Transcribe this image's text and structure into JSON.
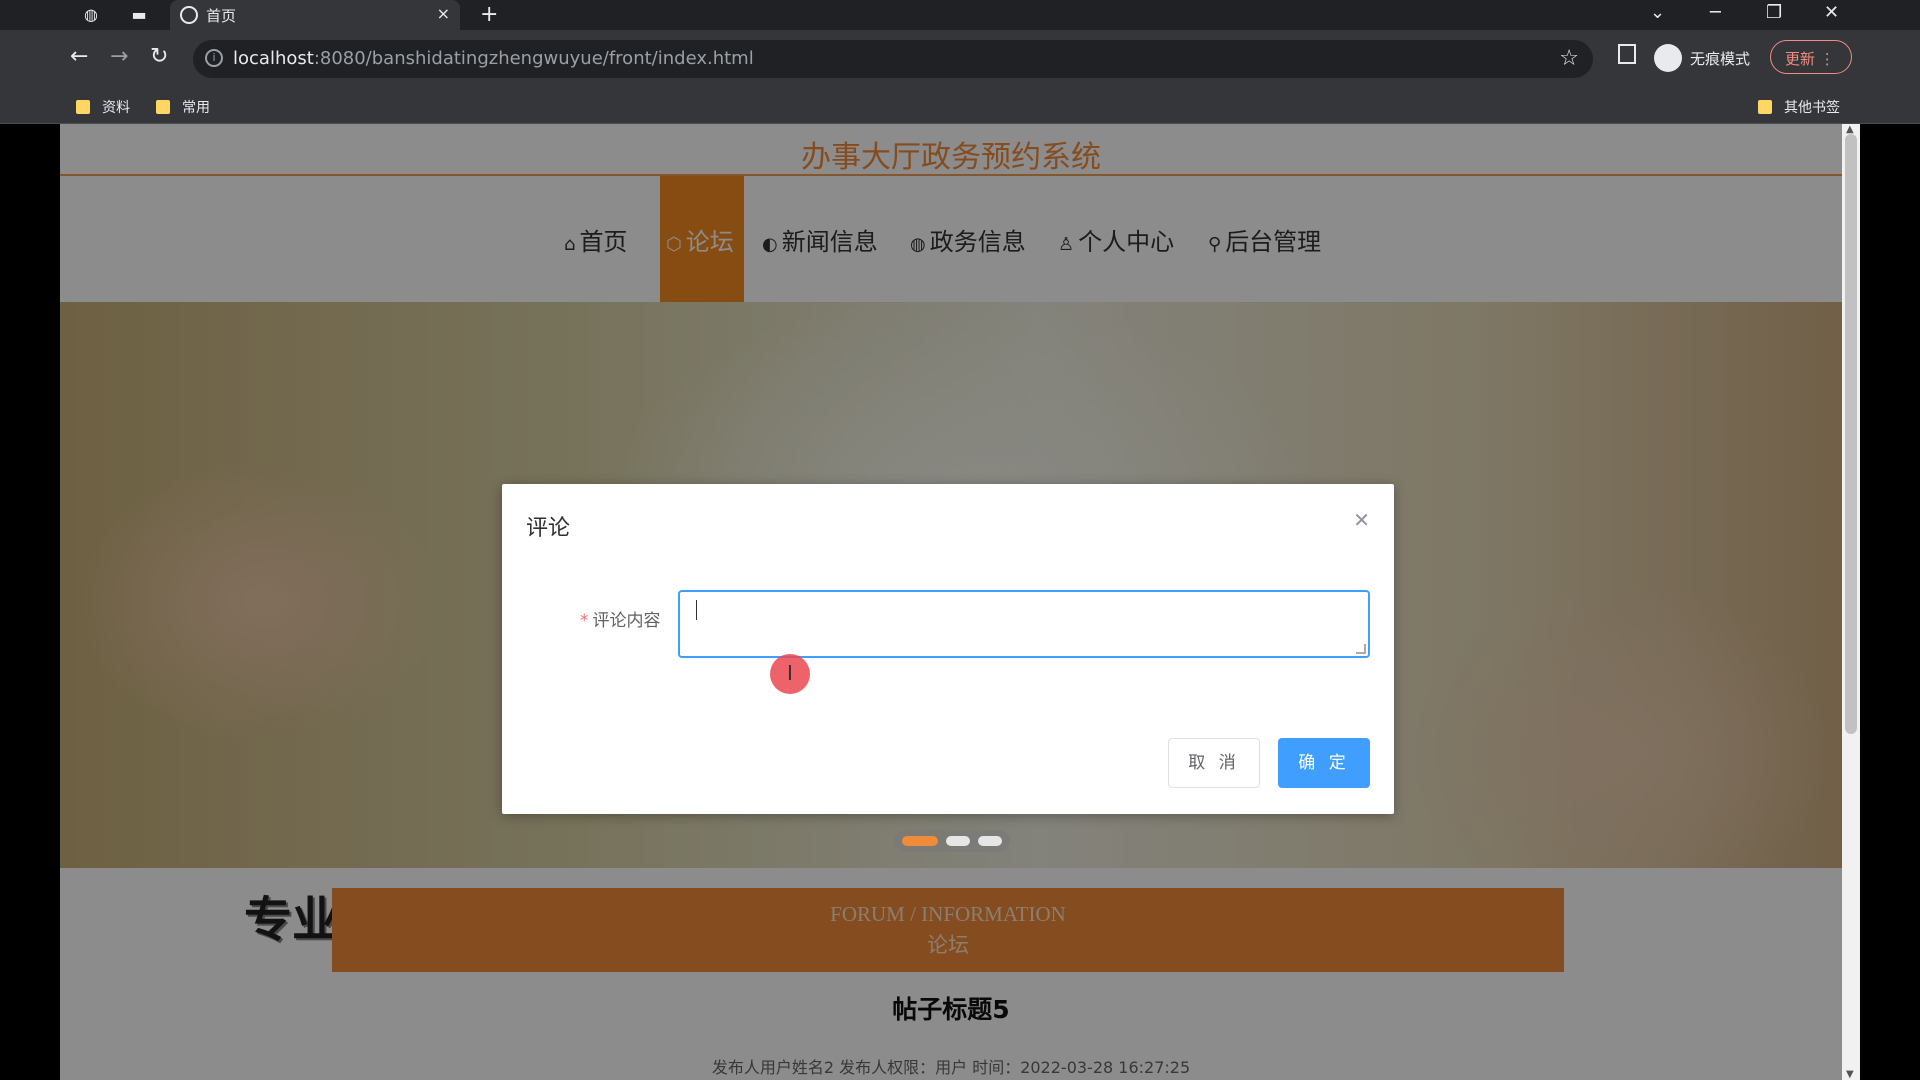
{
  "browser": {
    "tab_title": "首页",
    "tab_close": "×",
    "new_tab": "+",
    "url_host": "localhost",
    "url_rest": ":8080/banshidatingzhengwuyue/front/index.html",
    "incognito_label": "无痕模式",
    "update_label": "更新",
    "bookmarks": [
      "资料",
      "常用"
    ],
    "other_bookmarks": "其他书签"
  },
  "site": {
    "title": "办事大厅政务预约系统",
    "menu": [
      {
        "icon": "home-icon",
        "label": "首页"
      },
      {
        "icon": "cube-icon",
        "label": "论坛"
      },
      {
        "icon": "palette-icon",
        "label": "新闻信息"
      },
      {
        "icon": "globe-icon",
        "label": "政务信息"
      },
      {
        "icon": "user-icon",
        "label": "个人中心"
      },
      {
        "icon": "link-icon",
        "label": "后台管理"
      }
    ],
    "active_menu": "论坛",
    "accent_color": "#f68b22"
  },
  "carousel": {
    "slide_count": 3,
    "active_slide": 1
  },
  "section": {
    "watermark": "专业毕业设计",
    "heading_en": "FORUM / INFORMATION",
    "heading_cn": "论坛"
  },
  "post": {
    "title": "帖子标题5",
    "meta": "发布人用户姓名2   发布人权限：用户   时间：2022-03-28 16:27:25"
  },
  "dialog": {
    "title": "评论",
    "field_label": "评论内容",
    "required_mark": "*",
    "field_value": "",
    "cancel_label": "取 消",
    "confirm_label": "确 定",
    "primary_color": "#409eff"
  }
}
